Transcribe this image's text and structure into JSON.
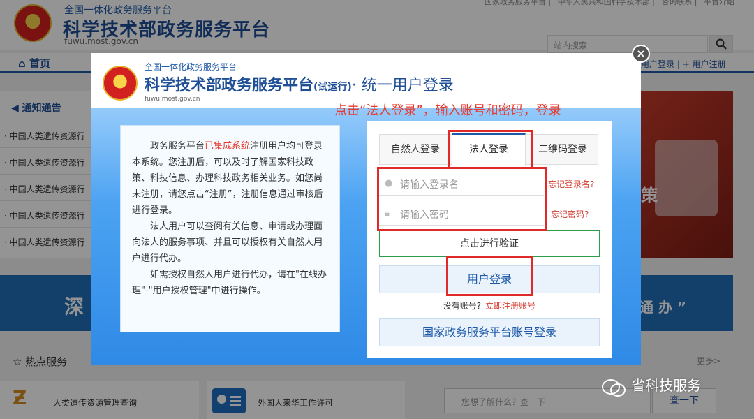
{
  "background": {
    "site_sup": "全国一体化政务服务平台",
    "site_title": "科学技术部政务服务平台",
    "site_url": "fuwu.most.gov.cn",
    "top_links": [
      "国家政务服务平台",
      "中华人民共和国科学技术部",
      "咨询联系",
      "平台介绍"
    ],
    "search_placeholder": "站内搜索",
    "nav_home": "首页",
    "nav_login": "用户登录",
    "nav_register": "用户注册",
    "notice_title": "通知通告",
    "notice_items": [
      "· 中国人类遗传资源行",
      "· 中国人类遗传资源行",
      "· 中国人类遗传资源行",
      "· 中国人类遗传资源行",
      "· 中国人类遗传资源行"
    ],
    "banner_char": "策",
    "band_left": "深",
    "band_right": "通 办 ”",
    "hot_title": "热点服务",
    "hot_items": [
      "人类遗传资源管理查询",
      "外国人来华工作许可"
    ],
    "more": "更多>",
    "faq_placeholder": "您想了解什么？查一下",
    "faq_button": "查一下",
    "watermark": "省科技服务"
  },
  "modal": {
    "sup": "全国一体化政务服务平台",
    "title": "科学技术部政务服务平台",
    "trial": "(试运行)",
    "unified": "· 统一用户登录",
    "url": "fuwu.most.gov.cn",
    "annotation": "点击“法人登录”，输入账号和密码，登录",
    "close": "×",
    "intro": {
      "p1_pre": "政务服务平台",
      "p1_highlight": "已集成系统",
      "p1_post": "注册用户均可登录本系统。您注册后，可以及时了解国家科技政策、科技信息、办理科技政务相关业务。如您尚未注册，请您点击“注册”，注册信息通过审核后进行登录。",
      "p2": "法人用户可以查阅有关信息、申请或办理面向法人的服务事项、并且可以授权有关自然人用户进行代办。",
      "p3": "如需授权自然人用户进行代办，请在\"在线办理\"-\"用户授权管理\"中进行操作。"
    },
    "tabs": [
      "自然人登录",
      "法人登录",
      "二维码登录"
    ],
    "active_tab": "法人登录",
    "username_placeholder": "请输入登录名",
    "password_placeholder": "请输入密码",
    "forgot_username": "忘记登录名?",
    "forgot_password": "忘记密码?",
    "verify": "点击进行验证",
    "login": "用户登录",
    "no_account": "没有账号?",
    "register_now": "立即注册账号",
    "national_login": "国家政务服务平台账号登录"
  },
  "colors": {
    "brand_blue": "#1e5aa8",
    "annotation_red": "#e83a2e",
    "highlight_box": "#e02a2a"
  }
}
